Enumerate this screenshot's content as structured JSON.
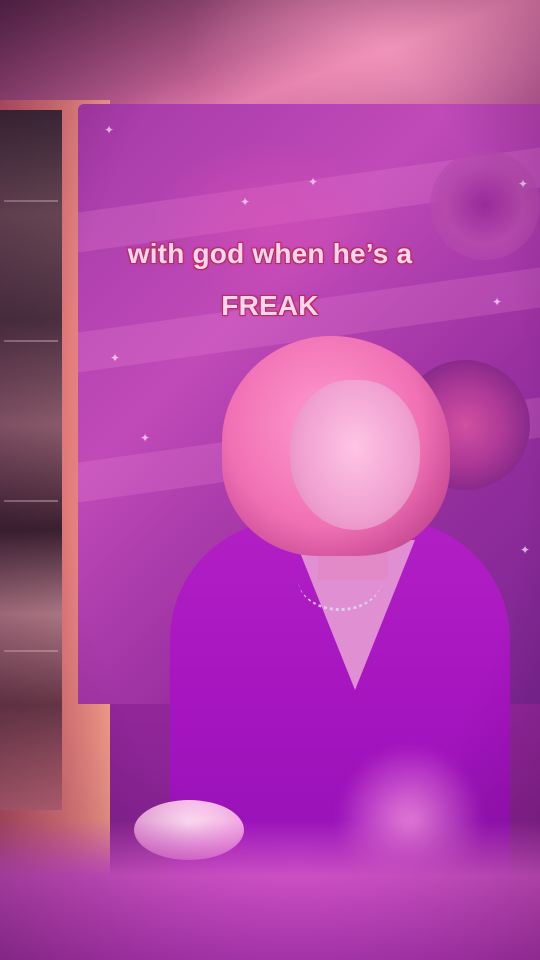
{
  "caption": {
    "line1": "with god when he’s a",
    "line2": "FREAK"
  }
}
